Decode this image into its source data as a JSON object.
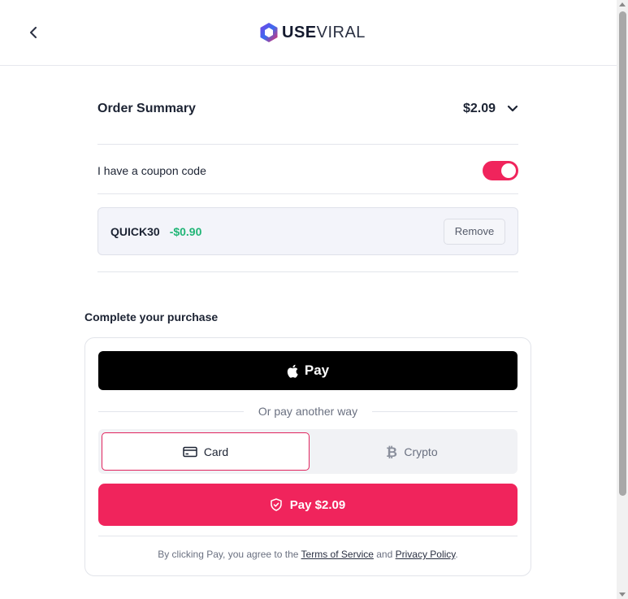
{
  "header": {
    "back_icon": "chevron-left-icon",
    "logo_icon": "hexagon-logo-icon",
    "logo_bold": "USE",
    "logo_light": "VIRAL"
  },
  "order_summary": {
    "title": "Order Summary",
    "total": "$2.09",
    "expand_icon": "chevron-down-icon"
  },
  "coupon": {
    "toggle_label": "I have a coupon code",
    "toggle_on": true,
    "code": "QUICK30",
    "discount": "-$0.90",
    "remove_label": "Remove"
  },
  "purchase": {
    "title": "Complete your purchase",
    "apple_pay_label": "Pay",
    "apple_icon": "apple-icon",
    "divider_text": "Or pay another way",
    "tabs": [
      {
        "label": "Card",
        "icon": "credit-card-icon",
        "selected": true
      },
      {
        "label": "Crypto",
        "icon": "bitcoin-icon",
        "selected": false
      }
    ],
    "pay_button_label": "Pay $2.09",
    "pay_icon": "shield-check-icon",
    "legal": {
      "prefix": "By clicking Pay, you agree to the",
      "terms": "Terms of Service",
      "and": "and",
      "privacy": "Privacy Policy",
      "suffix": "."
    }
  },
  "colors": {
    "accent": "#f0245c",
    "discount": "#20b576",
    "apple_pay_bg": "#000000"
  }
}
